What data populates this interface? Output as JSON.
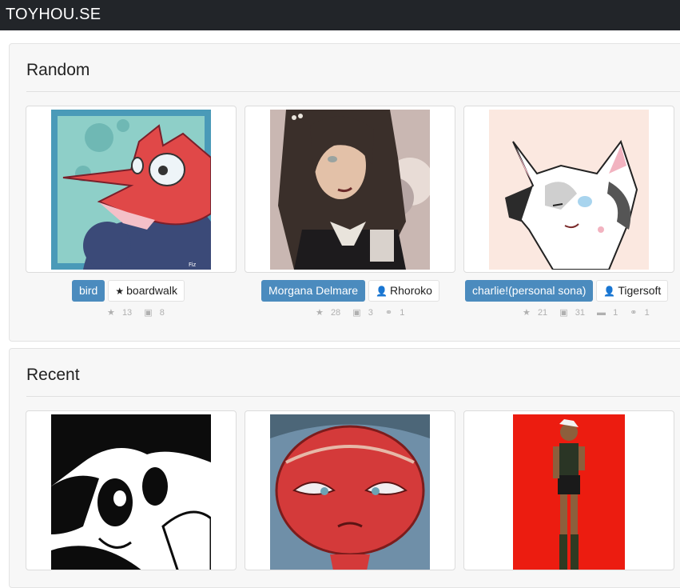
{
  "navbar": {
    "brand": "TOYHOU.SE"
  },
  "random": {
    "title": "Random",
    "cards": [
      {
        "name": "bird",
        "owner": "boardwalk",
        "owner_icon": "star-icon",
        "stats": {
          "favorites": "13",
          "images": "8"
        }
      },
      {
        "name": "Morgana Delmare",
        "owner": "Rhoroko",
        "owner_icon": "user-icon",
        "stats": {
          "favorites": "28",
          "images": "3",
          "links": "1"
        }
      },
      {
        "name": "charlie!(personal sona)",
        "owner": "Tigersoft",
        "owner_icon": "user-icon",
        "stats": {
          "favorites": "21",
          "images": "31",
          "comments": "1",
          "links": "1"
        }
      }
    ]
  },
  "recent": {
    "title": "Recent"
  },
  "colors": {
    "navbar": "#222529",
    "tag_blue": "#4b8bbe",
    "panel_bg": "#f7f7f7"
  }
}
